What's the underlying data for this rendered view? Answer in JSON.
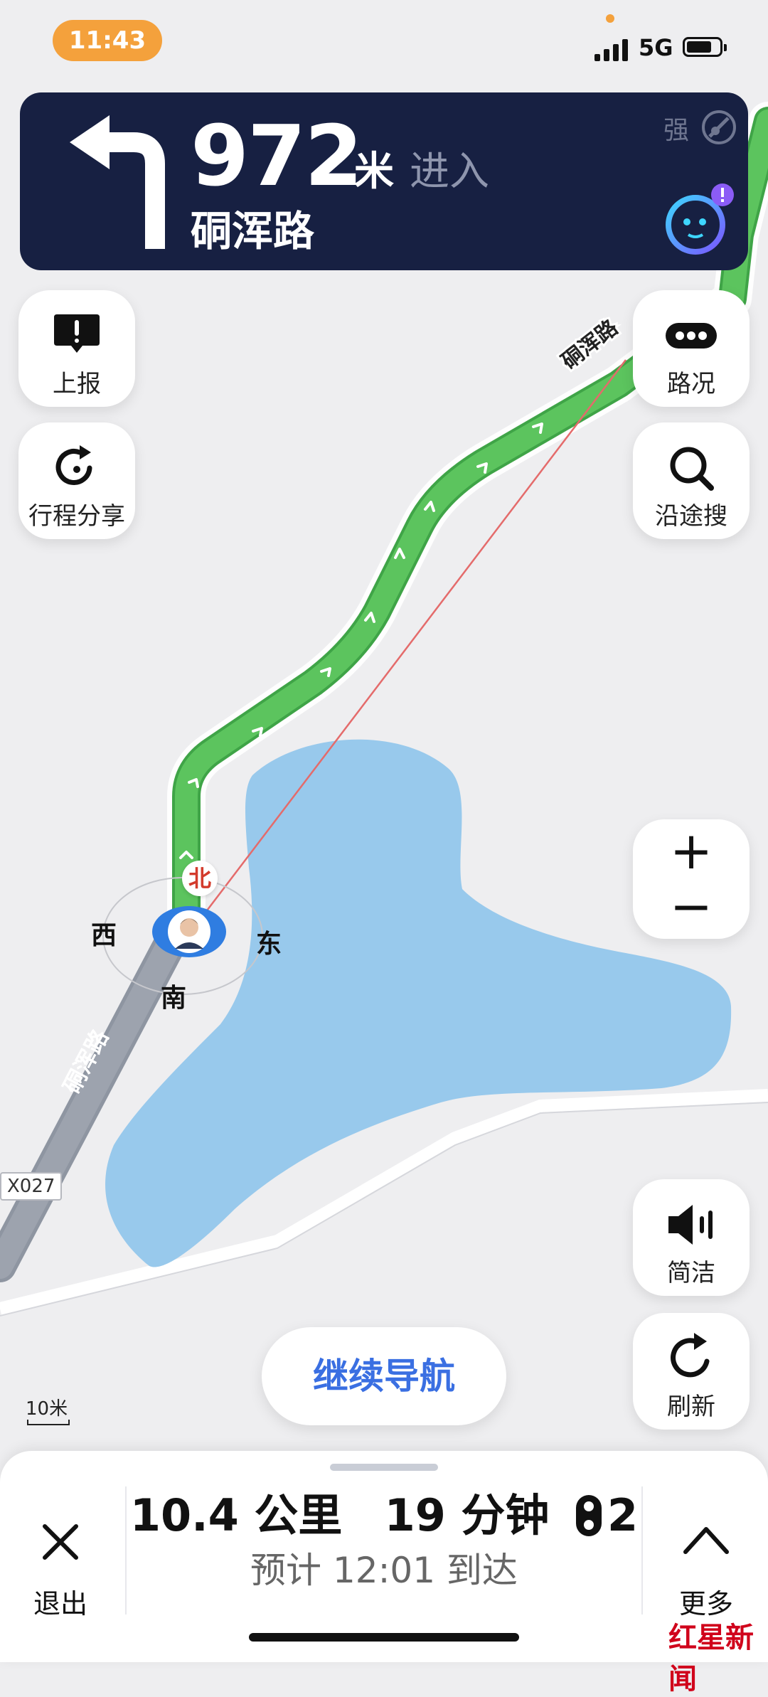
{
  "status_bar": {
    "time": "11:43",
    "network": "5G"
  },
  "nav": {
    "distance_value": "972",
    "distance_unit": "米",
    "action": "进入",
    "road_name": "硐浑路",
    "signal_strength": "强"
  },
  "left_buttons": {
    "report": "上报",
    "share_trip": "行程分享"
  },
  "right_buttons": {
    "traffic": "路况",
    "search_along": "沿途搜",
    "zoom_in": "+",
    "zoom_out": "−",
    "concise": "简洁",
    "refresh": "刷新"
  },
  "map": {
    "road_label_top": "硐浑路",
    "road_label_bottom": "硐浑路",
    "route_code": "X027",
    "compass": {
      "north": "北",
      "south": "南",
      "east": "东",
      "west": "西"
    },
    "scale": "10米",
    "colors": {
      "route": "#5cc45e",
      "water": "#98c9ec",
      "road": "#9da3ae",
      "guide_line": "#e46b6b"
    }
  },
  "continue_button": "继续导航",
  "bottom": {
    "exit": "退出",
    "more": "更多",
    "distance": "10.4 公里",
    "duration": "19 分钟",
    "traffic_lights": "2",
    "eta": "预计 12:01 到达"
  },
  "watermark": "红星新闻"
}
